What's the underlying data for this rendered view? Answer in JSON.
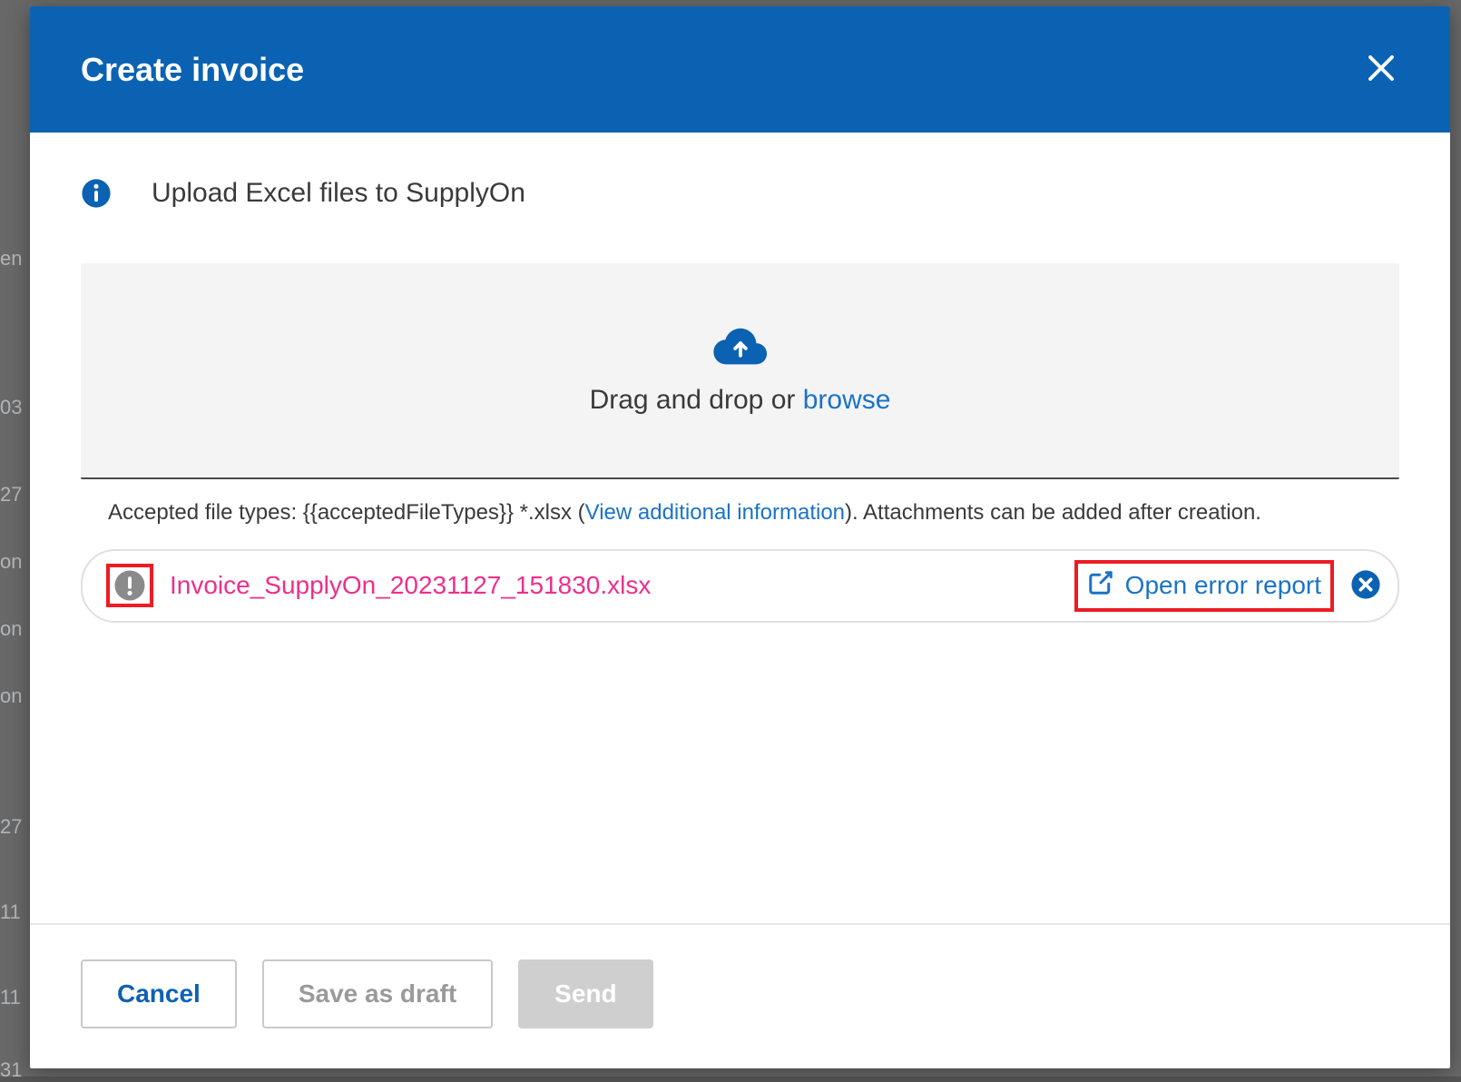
{
  "modal": {
    "title": "Create invoice"
  },
  "info": {
    "text": "Upload Excel files to SupplyOn"
  },
  "dropzone": {
    "prefix": "Drag and drop or ",
    "browse": "browse"
  },
  "accepted": {
    "prefix": "Accepted file types: {{acceptedFileTypes}} *.xlsx (",
    "view_link": "View additional information",
    "suffix": "). Attachments can be added after creation."
  },
  "file": {
    "name": "Invoice_SupplyOn_20231127_151830.xlsx",
    "error_report_label": "Open error report"
  },
  "footer": {
    "cancel": "Cancel",
    "save_draft": "Save as draft",
    "send": "Send"
  },
  "bg_fragments": [
    "en",
    "03",
    "27",
    "on",
    "on",
    "on",
    "27",
    "11",
    "11",
    "31"
  ],
  "colors": {
    "brand": "#0b62b3",
    "link": "#1a73c9",
    "highlight_red": "#ec1c24",
    "file_error_pink": "#ec2f8d"
  }
}
